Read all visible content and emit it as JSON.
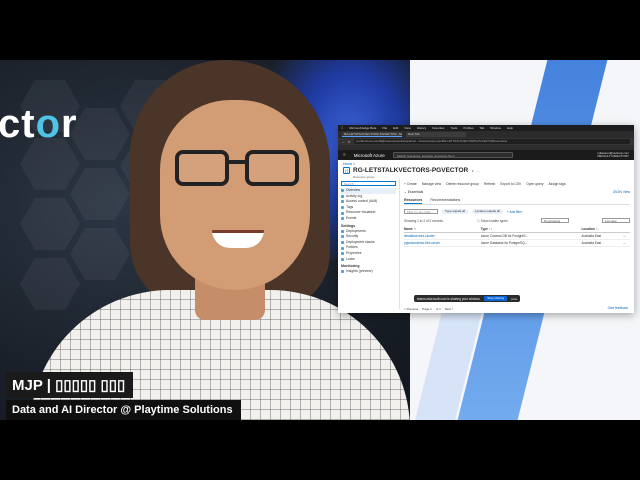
{
  "brand": {
    "text_prefix": "ct",
    "text_o": "o",
    "text_suffix": "r"
  },
  "lower_third": {
    "name": "MJP | ▯▯▯▯▯ ▯▯▯",
    "title": "Data and AI Director @ Playtime Solutions"
  },
  "browser": {
    "os_menu": [
      "Microsoft Edge Beta",
      "File",
      "Edit",
      "View",
      "History",
      "Favorites",
      "Tools",
      "Profiles",
      "Tab",
      "Window",
      "Help"
    ],
    "tabs": [
      {
        "label": "RG-LETSTALKVECTORS-PGVECTOR - Microsoft Azure",
        "active": true
      },
      {
        "label": "New Tab",
        "active": false
      }
    ],
    "url": "portal.azure.com/#@/resource/subscriptions/.../resourceGroups/RG-LETSTALKVECTORS-PGVECTOR/overview"
  },
  "azure": {
    "brand": "Microsoft Azure",
    "search_placeholder": "Search resources, services, and docs (G+/)",
    "account_line1": "mjlawson@outlook.com",
    "account_line2": "DEFAULT DIRECTORY",
    "breadcrumb": "Home >",
    "rg_title": "RG-LETSTALKVECTORS-PGVECTOR",
    "rg_subtitle": "Resource group",
    "nav_search_placeholder": "Search",
    "nav_items": [
      {
        "label": "Overview",
        "active": true
      },
      {
        "label": "Activity log",
        "active": false
      },
      {
        "label": "Access control (IAM)",
        "active": false
      },
      {
        "label": "Tags",
        "active": false
      },
      {
        "label": "Resource visualizer",
        "active": false
      },
      {
        "label": "Events",
        "active": false
      }
    ],
    "settings_section": "Settings",
    "settings_items": [
      "Deployments",
      "Security",
      "Deployment stacks",
      "Policies",
      "Properties",
      "Locks"
    ],
    "monitoring_section": "Monitoring",
    "monitoring_items": [
      "Insights (preview)"
    ],
    "commands": [
      "+ Create",
      "Manage view",
      "Delete resource group",
      "Refresh",
      "Export to CSV",
      "Open query",
      "Assign tags"
    ],
    "essentials_label": "Essentials",
    "json_view": "JSON View",
    "content_tabs": [
      "Resources",
      "Recommendations"
    ],
    "filter_placeholder": "Filter for any field...",
    "filter_pills": [
      "Type equals all",
      "Location equals all"
    ],
    "add_filter": "+ Add filter",
    "records_text": "Showing 1 to 2 of 2 records.",
    "show_hidden": "Show hidden types",
    "grouping": "No grouping",
    "view_mode": "List view",
    "table_headers": [
      "Name ↑↓",
      "Type ↑↓",
      "Location ↑↓"
    ],
    "resources": [
      {
        "name": "letstalkvectors-cluster",
        "type": "Azure Cosmos DB for PostgreS...",
        "location": "Australia East"
      },
      {
        "name": "pgvectordemo-flex-server",
        "type": "Azure Database for PostgreSQ...",
        "location": "Australia East"
      }
    ],
    "pager": [
      "< Previous",
      "Page 1",
      "of 1",
      "Next >"
    ],
    "feedback": "Give feedback"
  },
  "share_bar": {
    "message": "teams.microsoft.com is sharing your window.",
    "stop": "Stop sharing",
    "hide": "Hide"
  },
  "colors": {
    "accent": "#0078d4",
    "brand_o": "#4fc3e8",
    "azure_header": "#1b1b1b",
    "lower_third_bg": "#1a1a1a"
  }
}
